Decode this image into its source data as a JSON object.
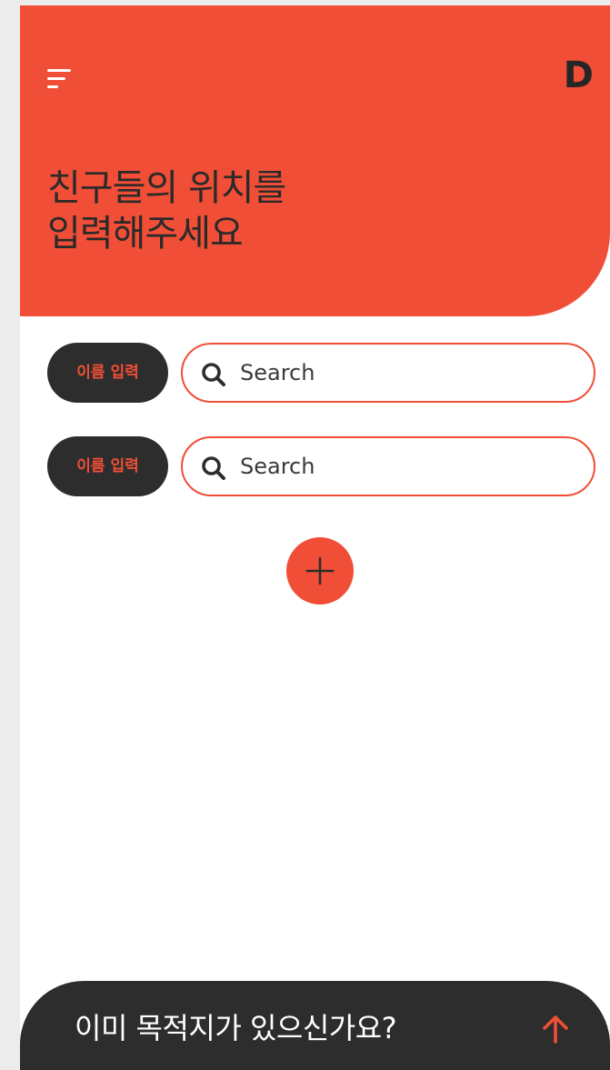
{
  "header": {
    "logo_text": "D",
    "title_line1": "친구들의 위치를",
    "title_line2": "입력해주세요"
  },
  "friends": [
    {
      "name_button_label": "이름 입력",
      "search_placeholder": "Search",
      "search_value": ""
    },
    {
      "name_button_label": "이름 입력",
      "search_placeholder": "Search",
      "search_value": ""
    }
  ],
  "add_button": {
    "icon": "plus-icon"
  },
  "bottom_bar": {
    "label": "이미 목적지가 있으신가요?",
    "icon": "arrow-up-icon"
  },
  "colors": {
    "accent": "#f04e36",
    "dark": "#2d2d2d",
    "background": "#ffffff"
  }
}
